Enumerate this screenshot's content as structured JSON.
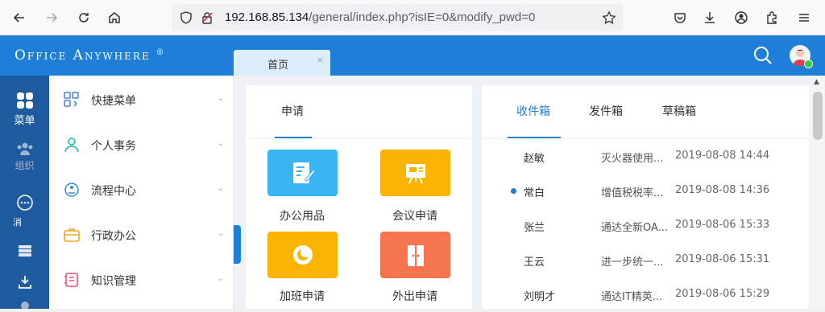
{
  "browser": {
    "url_host": "192.168.85.134",
    "url_path": "/general/index.php?isIE=0&modify_pwd=0"
  },
  "header": {
    "logo": "Office Anywhere",
    "logo_mark": "®",
    "home_tab": "首页",
    "close_glyph": "×"
  },
  "icon_strip": [
    {
      "label": "菜单"
    },
    {
      "label": "组织"
    },
    {
      "label": "消"
    }
  ],
  "menu": [
    {
      "label": "快捷菜单",
      "color": "#4a7fd6"
    },
    {
      "label": "个人事务",
      "color": "#1bb6a6"
    },
    {
      "label": "流程中心",
      "color": "#2b8fd8"
    },
    {
      "label": "行政办公",
      "color": "#f2a51b"
    },
    {
      "label": "知识管理",
      "color": "#e8557a"
    }
  ],
  "apply_card": {
    "tab": "申请",
    "apps": [
      {
        "label": "办公用品",
        "color": "#3ab4f2"
      },
      {
        "label": "会议申请",
        "color": "#f8b400"
      },
      {
        "label": "加班申请",
        "color": "#f8b400"
      },
      {
        "label": "外出申请",
        "color": "#f5734e"
      }
    ]
  },
  "mail_card": {
    "tabs": [
      "收件箱",
      "发件箱",
      "草稿箱"
    ],
    "rows": [
      {
        "from": "赵敏",
        "subject": "灭火器使用...",
        "date": "2019-08-08 14:44",
        "unread": false
      },
      {
        "from": "常白",
        "subject": "增值税税率...",
        "date": "2019-08-08 14:36",
        "unread": true
      },
      {
        "from": "张兰",
        "subject": "通达全新OA...",
        "date": "2019-08-06 15:33",
        "unread": false
      },
      {
        "from": "王云",
        "subject": "进一步统一...",
        "date": "2019-08-06 15:31",
        "unread": false
      },
      {
        "from": "刘明才",
        "subject": "通达IT精英...",
        "date": "2019-08-06 15:29",
        "unread": false
      }
    ]
  }
}
